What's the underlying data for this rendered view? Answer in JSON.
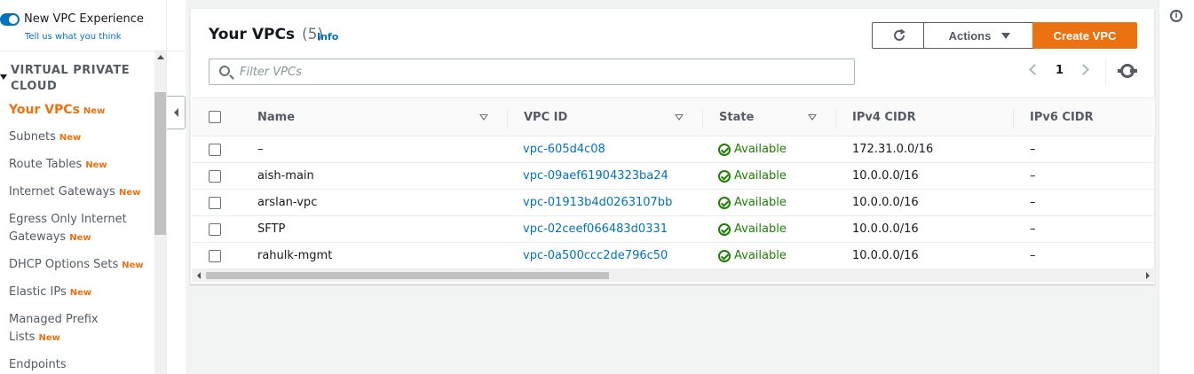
{
  "sidebar": {
    "toggle_label": "New VPC Experience",
    "feedback_link": "Tell us what you think",
    "section_title": "VIRTUAL PRIVATE CLOUD",
    "new_badge": "New",
    "items": [
      {
        "label": "Your VPCs",
        "active": true
      },
      {
        "label": "Subnets"
      },
      {
        "label": "Route Tables"
      },
      {
        "label": "Internet Gateways"
      },
      {
        "label": "Egress Only Internet Gateways"
      },
      {
        "label": "DHCP Options Sets"
      },
      {
        "label": "Elastic IPs"
      },
      {
        "label": "Managed Prefix Lists"
      },
      {
        "label": "Endpoints"
      }
    ],
    "egress_line1": "Egress Only Internet",
    "egress_line2": "Gateways",
    "prefix_line1": "Managed Prefix",
    "prefix_line2": "Lists"
  },
  "header": {
    "title": "Your VPCs",
    "count": "(5)",
    "info": "Info",
    "actions_label": "Actions",
    "create_label": "Create VPC"
  },
  "filter": {
    "placeholder": "Filter VPCs",
    "value": ""
  },
  "pagination": {
    "current_page": "1"
  },
  "table": {
    "columns": [
      "Name",
      "VPC ID",
      "State",
      "IPv4 CIDR",
      "IPv6 CIDR"
    ],
    "rows": [
      {
        "name": "–",
        "vpc_id": "vpc-605d4c08",
        "state": "Available",
        "ipv4": "172.31.0.0/16",
        "ipv6": "–"
      },
      {
        "name": "aish-main",
        "vpc_id": "vpc-09aef61904323ba24",
        "state": "Available",
        "ipv4": "10.0.0.0/16",
        "ipv6": "–"
      },
      {
        "name": "arslan-vpc",
        "vpc_id": "vpc-01913b4d0263107bb",
        "state": "Available",
        "ipv4": "10.0.0.0/16",
        "ipv6": "–"
      },
      {
        "name": "SFTP",
        "vpc_id": "vpc-02ceef066483d0331",
        "state": "Available",
        "ipv4": "10.0.0.0/16",
        "ipv6": "–"
      },
      {
        "name": "rahulk-mgmt",
        "vpc_id": "vpc-0a500ccc2de796c50",
        "state": "Available",
        "ipv4": "10.0.0.0/16",
        "ipv6": "–"
      }
    ]
  },
  "colors": {
    "accent": "#ec7211",
    "link": "#0073bb",
    "success": "#1d8102"
  },
  "icons": {
    "refresh": "refresh-icon",
    "settings": "gear-icon",
    "search": "search-icon",
    "info": "info-icon",
    "status": "check-circle-icon"
  }
}
